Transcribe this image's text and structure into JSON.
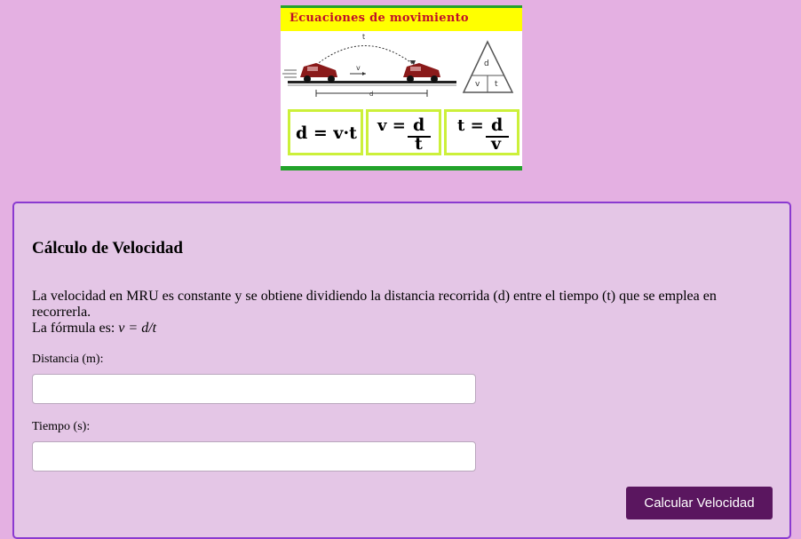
{
  "banner": {
    "title": "Ecuaciones  de  movimiento",
    "diagram_labels": {
      "t": "t",
      "v": "v",
      "d": "d"
    },
    "triangle": {
      "top": "d",
      "left": "v",
      "right": "t"
    },
    "formulas": {
      "f1": "d = v·t",
      "f2": {
        "lhs": "v =",
        "num": "d",
        "den": "t"
      },
      "f3": {
        "lhs": "t =",
        "num": "d",
        "den": "v"
      }
    },
    "colors": {
      "title_bg": "#ffff00",
      "title_text": "#c0102a",
      "border_green": "#22a32a",
      "box_border": "#ccf03a"
    }
  },
  "panel": {
    "title": "Cálculo de Velocidad",
    "description": "La velocidad en MRU es constante y se obtiene dividiendo la distancia recorrida (d) entre el tiempo (t) que se emplea en recorrerla.",
    "formula_prefix": "La fórmula es: ",
    "formula": "v = d/t",
    "distance_label": "Distancia (m):",
    "distance_value": "",
    "time_label": "Tiempo (s):",
    "time_value": "",
    "button_label": "Calcular Velocidad",
    "colors": {
      "page_bg": "#e4b0e2",
      "panel_bg": "#e4c6e6",
      "panel_border": "#8a3ad0",
      "button_bg": "#5a165f"
    }
  }
}
